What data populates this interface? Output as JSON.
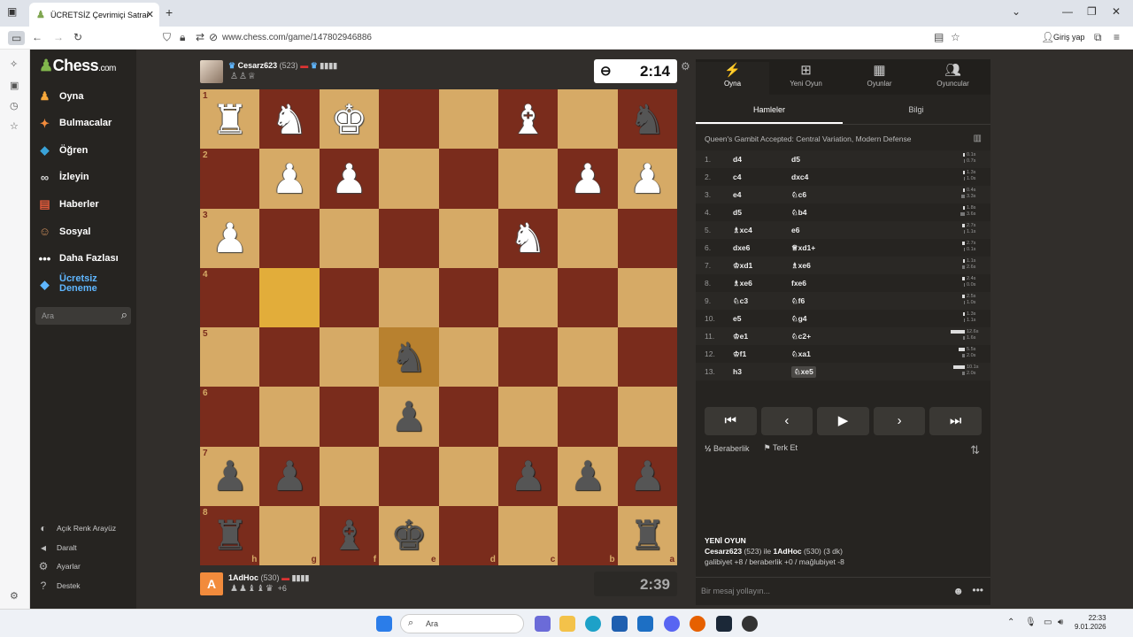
{
  "browser": {
    "tab_title": "ÜCRETSİZ Çevrimiçi Satranç",
    "url": "www.chess.com/game/147802946886",
    "login": "Giriş yap"
  },
  "sidebar": {
    "logo": "Chess",
    "logo_suffix": ".com",
    "items": [
      {
        "label": "Oyna",
        "icon": "play-pawn-icon",
        "color": "#f7a83b"
      },
      {
        "label": "Bulmacalar",
        "icon": "puzzle-icon",
        "color": "#f28b3c"
      },
      {
        "label": "Öğren",
        "icon": "learn-cube-icon",
        "color": "#3aa3d9"
      },
      {
        "label": "İzleyin",
        "icon": "binoculars-icon",
        "color": "#d9d9d9"
      },
      {
        "label": "Haberler",
        "icon": "news-icon",
        "color": "#e05a3b"
      },
      {
        "label": "Sosyal",
        "icon": "social-icon",
        "color": "#c98b5a"
      },
      {
        "label": "Daha Fazlası",
        "icon": "more-dots-icon",
        "color": "#ffffff"
      },
      {
        "label": "Ücretsiz Deneme",
        "icon": "diamond-icon",
        "color": "#5fb6ff"
      }
    ],
    "search_placeholder": "Ara",
    "footer": [
      {
        "label": "Açık Renk Arayüz",
        "icon": "theme-icon"
      },
      {
        "label": "Daralt",
        "icon": "collapse-icon"
      },
      {
        "label": "Ayarlar",
        "icon": "settings-icon"
      },
      {
        "label": "Destek",
        "icon": "help-icon"
      }
    ]
  },
  "top_player": {
    "name": "Cesarz623",
    "rating": "(523)",
    "captured": "♙♙♕",
    "clock": "2:14"
  },
  "bottom_player": {
    "name": "1AdHoc",
    "rating": "(530)",
    "captured": "♟♟♝♝♛",
    "advantage": "+6",
    "clock": "2:39",
    "avatar_letter": "A"
  },
  "board": {
    "ranks": [
      "1",
      "2",
      "3",
      "4",
      "5",
      "6",
      "7",
      "8"
    ],
    "files": [
      "h",
      "g",
      "f",
      "e",
      "d",
      "c",
      "b",
      "a"
    ],
    "light": "#d6aa66",
    "dark": "#7a2c1c",
    "highlight": "#e2ad3a",
    "rows": [
      [
        "wR",
        "wN",
        "wK",
        "",
        "",
        "wB",
        "",
        "bN"
      ],
      [
        "",
        "wP",
        "wP",
        "",
        "",
        "",
        "wP",
        "wP"
      ],
      [
        "wP",
        "",
        "",
        "",
        "",
        "wN",
        "",
        ""
      ],
      [
        "",
        "",
        "",
        "",
        "",
        "",
        "",
        ""
      ],
      [
        "",
        "",
        "",
        "bN",
        "",
        "",
        "",
        ""
      ],
      [
        "",
        "",
        "",
        "bP",
        "",
        "",
        "",
        ""
      ],
      [
        "bP",
        "bP",
        "",
        "",
        "",
        "bP",
        "bP",
        "bP"
      ],
      [
        "bR",
        "",
        "bB",
        "bK",
        "",
        "",
        "",
        "bR"
      ]
    ],
    "highlights": [
      [
        3,
        1
      ],
      [
        4,
        3
      ]
    ]
  },
  "panel": {
    "tabs": [
      {
        "label": "Oyna",
        "icon": "bolt-icon"
      },
      {
        "label": "Yeni Oyun",
        "icon": "plus-icon"
      },
      {
        "label": "Oyunlar",
        "icon": "board-icon"
      },
      {
        "label": "Oyuncular",
        "icon": "players-icon"
      }
    ],
    "subtabs": [
      "Hamleler",
      "Bilgi"
    ],
    "opening": "Queen's Gambit Accepted: Central Variation, Modern Defense",
    "moves": [
      {
        "n": "1.",
        "w": "d4",
        "b": "d5",
        "tw": "0.1s",
        "tb": "0.7s",
        "vw": 0.1,
        "vb": 0.7
      },
      {
        "n": "2.",
        "w": "c4",
        "b": "dxc4",
        "tw": "1.3s",
        "tb": "1.0s",
        "vw": 1.3,
        "vb": 1.0
      },
      {
        "n": "3.",
        "w": "e4",
        "b": "♘c6",
        "tw": "0.4s",
        "tb": "3.3s",
        "vw": 0.4,
        "vb": 3.3
      },
      {
        "n": "4.",
        "w": "d5",
        "b": "♘b4",
        "tw": "1.8s",
        "tb": "3.6s",
        "vw": 1.8,
        "vb": 3.6
      },
      {
        "n": "5.",
        "w": "♗xc4",
        "b": "e6",
        "tw": "2.7s",
        "tb": "1.1s",
        "vw": 2.7,
        "vb": 1.1
      },
      {
        "n": "6.",
        "w": "dxe6",
        "b": "♕xd1+",
        "tw": "2.7s",
        "tb": "0.1s",
        "vw": 2.7,
        "vb": 0.1
      },
      {
        "n": "7.",
        "w": "♔xd1",
        "b": "♗xe6",
        "tw": "1.1s",
        "tb": "2.6s",
        "vw": 1.1,
        "vb": 2.6
      },
      {
        "n": "8.",
        "w": "♗xe6",
        "b": "fxe6",
        "tw": "2.4s",
        "tb": "0.0s",
        "vw": 2.4,
        "vb": 0.0
      },
      {
        "n": "9.",
        "w": "♘c3",
        "b": "♘f6",
        "tw": "2.5s",
        "tb": "1.0s",
        "vw": 2.5,
        "vb": 1.0
      },
      {
        "n": "10.",
        "w": "e5",
        "b": "♘g4",
        "tw": "1.3s",
        "tb": "1.1s",
        "vw": 1.3,
        "vb": 1.1
      },
      {
        "n": "11.",
        "w": "♔e1",
        "b": "♘c2+",
        "tw": "12.6s",
        "tb": "1.6s",
        "vw": 12.6,
        "vb": 1.6
      },
      {
        "n": "12.",
        "w": "♔f1",
        "b": "♘xa1",
        "tw": "5.5s",
        "tb": "2.0s",
        "vw": 5.5,
        "vb": 2.0
      },
      {
        "n": "13.",
        "w": "h3",
        "b": "♘xe5",
        "tw": "10.1s",
        "tb": "2.0s",
        "vw": 10.1,
        "vb": 2.0,
        "current": true
      }
    ],
    "draw": "Beraberlik",
    "resign": "Terk Et",
    "new_game_title": "YENİ OYUN",
    "new_game_line1_a": "Cesarz623",
    "new_game_line1_b": "(523) ile",
    "new_game_line1_c": "1AdHoc",
    "new_game_line1_d": "(530) (3 dk)",
    "new_game_line2": "galibiyet +8 / beraberlik +0 / mağlubiyet -8",
    "message_placeholder": "Bir mesaj yollayın..."
  },
  "taskbar": {
    "search": "Ara",
    "time": "22:33",
    "date": "9.01.2026"
  }
}
